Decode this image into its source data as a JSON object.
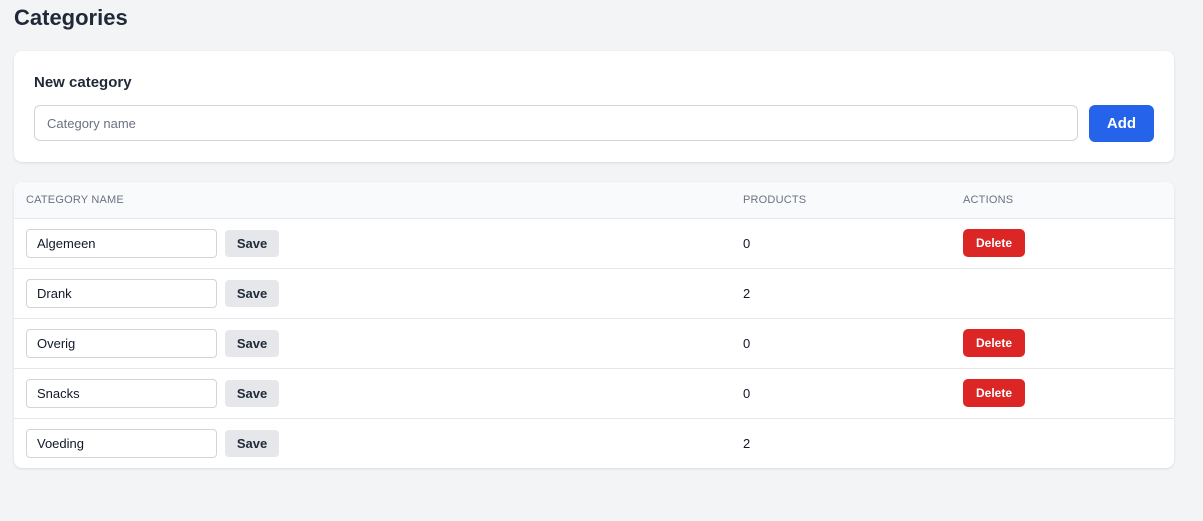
{
  "page": {
    "title": "Categories"
  },
  "new_category": {
    "title": "New category",
    "placeholder": "Category name",
    "value": "",
    "add_label": "Add"
  },
  "table": {
    "headers": {
      "name": "CATEGORY NAME",
      "products": "PRODUCTS",
      "actions": "ACTIONS"
    },
    "rows": [
      {
        "name": "Algemeen",
        "products": "0",
        "save_label": "Save",
        "delete_label": "Delete",
        "can_delete": true
      },
      {
        "name": "Drank",
        "products": "2",
        "save_label": "Save",
        "delete_label": "",
        "can_delete": false
      },
      {
        "name": "Overig",
        "products": "0",
        "save_label": "Save",
        "delete_label": "Delete",
        "can_delete": true
      },
      {
        "name": "Snacks",
        "products": "0",
        "save_label": "Save",
        "delete_label": "Delete",
        "can_delete": true
      },
      {
        "name": "Voeding",
        "products": "2",
        "save_label": "Save",
        "delete_label": "",
        "can_delete": false
      }
    ]
  },
  "colors": {
    "primary": "#2563eb",
    "danger": "#dc2626",
    "background": "#f3f4f6"
  }
}
